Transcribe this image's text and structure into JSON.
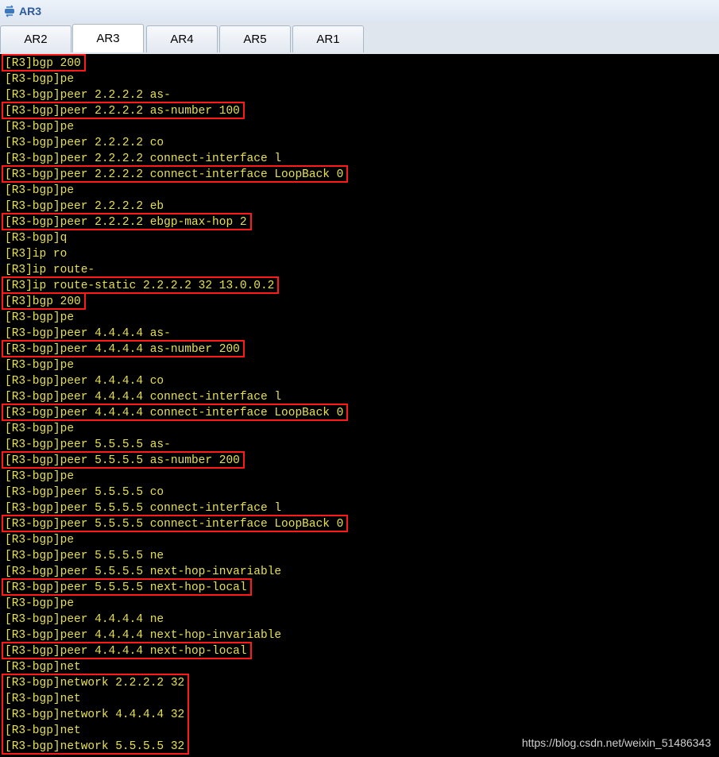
{
  "window": {
    "title": "AR3",
    "icon": "router-icon"
  },
  "tabs": [
    {
      "label": "AR2",
      "active": false
    },
    {
      "label": "AR3",
      "active": true
    },
    {
      "label": "AR4",
      "active": false
    },
    {
      "label": "AR5",
      "active": false
    },
    {
      "label": "AR1",
      "active": false
    }
  ],
  "console": {
    "text_color": "#e6e04a",
    "highlight_color": "#ff1a1a",
    "lines": [
      {
        "text": "[R3]bgp 200",
        "highlight": true
      },
      {
        "text": "[R3-bgp]pe",
        "highlight": false
      },
      {
        "text": "[R3-bgp]peer 2.2.2.2 as-",
        "highlight": false
      },
      {
        "text": "[R3-bgp]peer 2.2.2.2 as-number 100",
        "highlight": true
      },
      {
        "text": "[R3-bgp]pe",
        "highlight": false
      },
      {
        "text": "[R3-bgp]peer 2.2.2.2 co",
        "highlight": false
      },
      {
        "text": "[R3-bgp]peer 2.2.2.2 connect-interface l",
        "highlight": false
      },
      {
        "text": "[R3-bgp]peer 2.2.2.2 connect-interface LoopBack 0",
        "highlight": true
      },
      {
        "text": "[R3-bgp]pe",
        "highlight": false
      },
      {
        "text": "[R3-bgp]peer 2.2.2.2 eb",
        "highlight": false
      },
      {
        "text": "[R3-bgp]peer 2.2.2.2 ebgp-max-hop 2",
        "highlight": true
      },
      {
        "text": "[R3-bgp]q",
        "highlight": false
      },
      {
        "text": "[R3]ip ro",
        "highlight": false
      },
      {
        "text": "[R3]ip route-",
        "highlight": false
      },
      {
        "text": "[R3]ip route-static 2.2.2.2 32 13.0.0.2",
        "highlight": true
      },
      {
        "text": "[R3]bgp 200",
        "highlight": true
      },
      {
        "text": "[R3-bgp]pe",
        "highlight": false
      },
      {
        "text": "[R3-bgp]peer 4.4.4.4 as-",
        "highlight": false
      },
      {
        "text": "[R3-bgp]peer 4.4.4.4 as-number 200",
        "highlight": true
      },
      {
        "text": "[R3-bgp]pe",
        "highlight": false
      },
      {
        "text": "[R3-bgp]peer 4.4.4.4 co",
        "highlight": false
      },
      {
        "text": "[R3-bgp]peer 4.4.4.4 connect-interface l",
        "highlight": false
      },
      {
        "text": "[R3-bgp]peer 4.4.4.4 connect-interface LoopBack 0",
        "highlight": true
      },
      {
        "text": "[R3-bgp]pe",
        "highlight": false
      },
      {
        "text": "[R3-bgp]peer 5.5.5.5 as-",
        "highlight": false
      },
      {
        "text": "[R3-bgp]peer 5.5.5.5 as-number 200",
        "highlight": true
      },
      {
        "text": "[R3-bgp]pe",
        "highlight": false
      },
      {
        "text": "[R3-bgp]peer 5.5.5.5 co",
        "highlight": false
      },
      {
        "text": "[R3-bgp]peer 5.5.5.5 connect-interface l",
        "highlight": false
      },
      {
        "text": "[R3-bgp]peer 5.5.5.5 connect-interface LoopBack 0",
        "highlight": true
      },
      {
        "text": "[R3-bgp]pe",
        "highlight": false
      },
      {
        "text": "[R3-bgp]peer 5.5.5.5 ne",
        "highlight": false
      },
      {
        "text": "[R3-bgp]peer 5.5.5.5 next-hop-invariable",
        "highlight": false
      },
      {
        "text": "[R3-bgp]peer 5.5.5.5 next-hop-local",
        "highlight": true
      },
      {
        "text": "[R3-bgp]pe",
        "highlight": false
      },
      {
        "text": "[R3-bgp]peer 4.4.4.4 ne",
        "highlight": false
      },
      {
        "text": "[R3-bgp]peer 4.4.4.4 next-hop-invariable",
        "highlight": false
      },
      {
        "text": "[R3-bgp]peer 4.4.4.4 next-hop-local",
        "highlight": true
      },
      {
        "text": "[R3-bgp]net",
        "highlight": false
      },
      {
        "text": "[R3-bgp]network 2.2.2.2 32",
        "highlight": false
      },
      {
        "text": "[R3-bgp]net",
        "highlight": false
      },
      {
        "text": "[R3-bgp]network 4.4.4.4 32",
        "highlight": false
      },
      {
        "text": "[R3-bgp]net",
        "highlight": false
      },
      {
        "text": "[R3-bgp]network 5.5.5.5 32",
        "highlight": false
      }
    ]
  },
  "watermark": "https://blog.csdn.net/weixin_51486343"
}
